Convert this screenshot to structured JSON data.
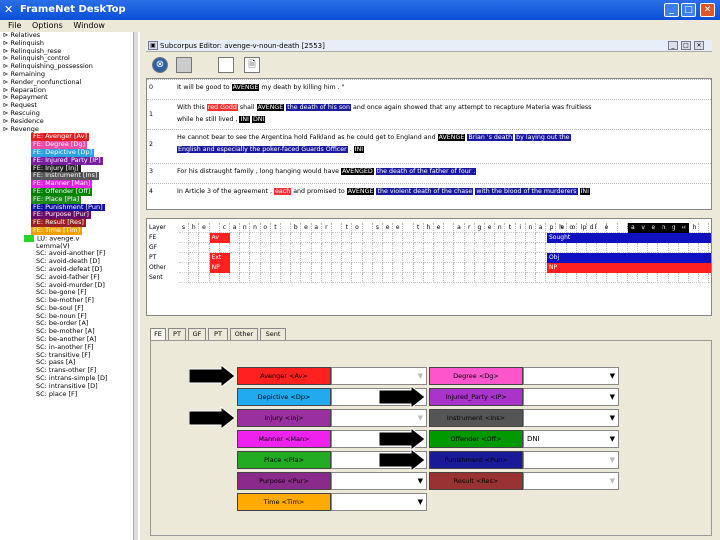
{
  "window": {
    "title": "FrameNet DeskTop"
  },
  "menu": [
    "File",
    "Options",
    "Window"
  ],
  "tree": {
    "items": [
      "Relatives",
      "Relinquish",
      "Relinquish_rese",
      "Relinquish_control",
      "Relinquishing_possession",
      "Remaining",
      "Render_nonfunctional",
      "Reparation",
      "Repayment",
      "Request",
      "Rescuing",
      "Residence",
      "Revenge"
    ],
    "frame_elements": [
      {
        "label": "FE: Avenger [Av]",
        "color": "#e02020"
      },
      {
        "label": "FE: Degree [Dg]",
        "color": "#ee4aa6"
      },
      {
        "label": "FE: Depictive [Dp]",
        "color": "#2aa0e0"
      },
      {
        "label": "FE: Injured_Party [IP]",
        "color": "#7a1ea0"
      },
      {
        "label": "FE: Injury [Inj]",
        "color": "#222222"
      },
      {
        "label": "FE: Instrument [Ins]",
        "color": "#555555"
      },
      {
        "label": "FE: Manner [Man]",
        "color": "#e020e0"
      },
      {
        "label": "FE: Offender [Off]",
        "color": "#008000"
      },
      {
        "label": "FE: Place [Pla]",
        "color": "#1a8a1a"
      },
      {
        "label": "FE: Punishment [Pun]",
        "color": "#1010a0"
      },
      {
        "label": "FE: Purpose [Pur]",
        "color": "#6a0a6a"
      },
      {
        "label": "FE: Result [Res]",
        "color": "#9a2020"
      },
      {
        "label": "FE: Time [Tim]",
        "color": "#f0a000"
      }
    ],
    "lu": "LU: avenge.v",
    "lu_children": [
      "Lemma(V)",
      "SC: avoid-another [F]",
      "SC: avoid-death [D]",
      "SC: avoid-defeat [D]",
      "SC: avoid-father [F]",
      "SC: avoid-murder [D]",
      "SC: be-gone [F]",
      "SC: be-mother [F]",
      "SC: be-soul [F]",
      "SC: be-noun [F]",
      "SC: be-order [A]",
      "SC: be-mother [A]",
      "SC: be-another [A]",
      "SC: in-another [F]",
      "SC: transitive [F]",
      "SC: pass [A]",
      "SC: trans-other [F]",
      "SC: intrans-simple [D]",
      "SC: intransitive [D]",
      "SC: place [F]"
    ]
  },
  "frame_window": {
    "title": "Subcorpus Editor: avenge-v-noun-death [2553]"
  },
  "sentences": [
    {
      "num": "0",
      "lines": [
        [
          {
            "t": "It will be good to "
          },
          {
            "t": "AVENGE",
            "bg": "#000",
            "fg": "#fff"
          },
          {
            "t": " my death by killing him . \""
          }
        ]
      ]
    },
    {
      "num": "1",
      "lines": [
        [
          {
            "t": "With this "
          },
          {
            "t": "red Godd",
            "bg": "#ff3030",
            "fg": "#fff"
          },
          {
            "t": " shall "
          },
          {
            "t": "AVENGE",
            "bg": "#000",
            "fg": "#fff"
          },
          {
            "t": " "
          },
          {
            "t": "the death of his son",
            "bg": "#1a1aa0",
            "fg": "#fff"
          },
          {
            "t": " and once again showed that any attempt to recapture Materia was fruitless"
          }
        ],
        [
          {
            "t": "while he still lived , "
          },
          {
            "t": "INI",
            "bg": "#000",
            "fg": "#fff"
          },
          {
            "t": " "
          },
          {
            "t": "DNI",
            "bg": "#000",
            "fg": "#fff"
          }
        ]
      ]
    },
    {
      "num": "2",
      "lines": [
        [
          {
            "t": "He cannot bear to see the Argentina hold Falkland as he could get to England and "
          },
          {
            "t": "AVENGE",
            "bg": "#000",
            "fg": "#fff"
          },
          {
            "t": " "
          },
          {
            "t": "Brian 's death",
            "bg": "#1a1aa0",
            "fg": "#fff"
          },
          {
            "t": " "
          },
          {
            "t": "by laying out the",
            "bg": "#1a1aa0",
            "fg": "#fff"
          }
        ],
        [
          {
            "t": "English and especially the poker-faced Guards Officer",
            "bg": "#1a1aa0",
            "fg": "#fff"
          },
          {
            "t": " . "
          },
          {
            "t": "INI",
            "bg": "#000",
            "fg": "#fff"
          }
        ]
      ]
    },
    {
      "num": "3",
      "lines": [
        [
          {
            "t": "For his distraught family , long hanging would have "
          },
          {
            "t": "AVENGED",
            "bg": "#000",
            "fg": "#fff"
          },
          {
            "t": " "
          },
          {
            "t": "the death of the father of four .",
            "bg": "#1a1aa0",
            "fg": "#fff"
          }
        ]
      ]
    },
    {
      "num": "4",
      "lines": [
        [
          {
            "t": "In Article 3 of the agreement , "
          },
          {
            "t": "each",
            "bg": "#ff3030",
            "fg": "#fff"
          },
          {
            "t": " and promised to "
          },
          {
            "t": "AVENGE",
            "bg": "#000",
            "fg": "#fff"
          },
          {
            "t": " "
          },
          {
            "t": "the violent death of the chase",
            "bg": "#1a1aa0",
            "fg": "#fff"
          },
          {
            "t": " "
          },
          {
            "t": "with the blood of the murderers",
            "bg": "#1a1aa0",
            "fg": "#fff"
          },
          {
            "t": " "
          },
          {
            "t": "INI",
            "bg": "#000",
            "fg": "#fff"
          }
        ]
      ]
    }
  ],
  "grid": {
    "row_labels": [
      "Layer",
      "FE",
      "GF",
      "PT",
      "Other",
      "Sent"
    ],
    "letters": [
      "s",
      "h",
      "e",
      "",
      "c",
      "a",
      "n",
      "n",
      "o",
      "t",
      "",
      "b",
      "e",
      "a",
      "r",
      "",
      "t",
      "o",
      "",
      "s",
      "e",
      "e",
      "",
      "t",
      "h",
      "e",
      "",
      "a",
      "r",
      "g",
      "e",
      "n",
      "t",
      "i",
      "n",
      "a",
      "",
      "h",
      "o",
      "l",
      "d"
    ],
    "marks": [
      {
        "row": 1,
        "col": 3,
        "label": "Av",
        "color": "#ff2020"
      },
      {
        "row": 3,
        "col": 3,
        "label": "Ext",
        "color": "#ff2020"
      },
      {
        "row": 4,
        "col": 3,
        "label": "NP",
        "color": "#ff2020"
      },
      {
        "row": 1,
        "col": 51,
        "label": "Sought",
        "color": "#1010c0"
      },
      {
        "row": 3,
        "col": 51,
        "label": "Obj",
        "color": "#1010c0"
      },
      {
        "row": 4,
        "col": 51,
        "label": "NP",
        "color": "#ff2020"
      }
    ],
    "highlight": [
      "a",
      "v",
      "e",
      "n",
      "g",
      "e"
    ]
  },
  "tabs": [
    "FE",
    "PT",
    "GF",
    "PT",
    "Other",
    "Sent"
  ],
  "fe_buttons": {
    "left": [
      {
        "label": "Avenger <Av>",
        "color": "#ff2020"
      },
      {
        "label": "Depictive <Dp>",
        "color": "#22aaee"
      },
      {
        "label": "Injury <Inj>",
        "color": "#9a30a0"
      },
      {
        "label": "Manner <Man>",
        "color": "#ee22ee"
      },
      {
        "label": "Place <Pla>",
        "color": "#22aa22"
      },
      {
        "label": "Purpose <Pur>",
        "color": "#8a2a8a"
      },
      {
        "label": "Time <Tim>",
        "color": "#ffaa00"
      }
    ],
    "right": [
      {
        "label": "Degree <Dg>",
        "color": "#ff55cc"
      },
      {
        "label": "Injured_Party <IP>",
        "color": "#aa33cc"
      },
      {
        "label": "Instrument <Ins>",
        "color": "#555555"
      },
      {
        "label": "Offender <Off>",
        "color": "#009900"
      },
      {
        "label": "Punishment <Pun>",
        "color": "#1a1a99"
      },
      {
        "label": "Result <Res>",
        "color": "#993333"
      }
    ],
    "dropdowns_left": [
      "",
      "",
      "",
      "",
      "",
      "",
      ""
    ],
    "dropdowns_right": [
      "",
      "",
      "",
      "DNI",
      "",
      "",
      ""
    ]
  },
  "colors": {
    "arrow": "#000000"
  },
  "icons": [
    "close-icon",
    "document-icon",
    "layout-icon",
    "file-icon"
  ]
}
